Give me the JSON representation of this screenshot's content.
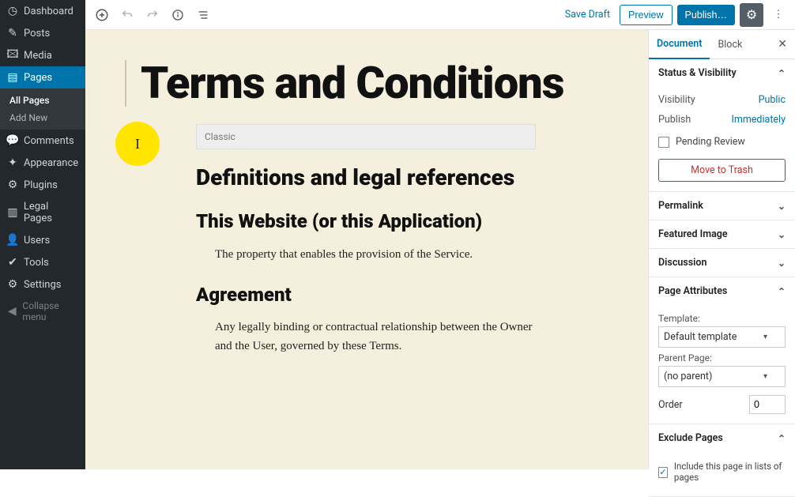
{
  "sidebar": {
    "items": [
      {
        "label": "Dashboard",
        "icon": "◷"
      },
      {
        "label": "Posts",
        "icon": "✎"
      },
      {
        "label": "Media",
        "icon": "🖾"
      },
      {
        "label": "Pages",
        "icon": "▤",
        "active": true
      },
      {
        "label": "Comments",
        "icon": "💬"
      },
      {
        "label": "Appearance",
        "icon": "✦"
      },
      {
        "label": "Plugins",
        "icon": "⚙"
      },
      {
        "label": "Legal Pages",
        "icon": "▥"
      },
      {
        "label": "Users",
        "icon": "👤"
      },
      {
        "label": "Tools",
        "icon": "✔"
      },
      {
        "label": "Settings",
        "icon": "⚙"
      }
    ],
    "subitems": [
      {
        "label": "All Pages",
        "current": true
      },
      {
        "label": "Add New"
      }
    ],
    "collapse": "Collapse menu"
  },
  "topbar": {
    "save_draft": "Save Draft",
    "preview": "Preview",
    "publish": "Publish…"
  },
  "editor": {
    "cursor_char": "I",
    "title": "Terms and Conditions",
    "classic_label": "Classic",
    "h2_1": "Definitions and legal references",
    "h3_1": "This Website (or this Application)",
    "p_1": "The property that enables the provision of the Service.",
    "h3_2": "Agreement",
    "p_2": "Any legally binding or contractual relationship between the Owner and the User, governed by these Terms."
  },
  "inspector": {
    "tabs": {
      "document": "Document",
      "block": "Block"
    },
    "status": {
      "title": "Status & Visibility",
      "visibility_label": "Visibility",
      "visibility_value": "Public",
      "publish_label": "Publish",
      "publish_value": "Immediately",
      "pending_label": "Pending Review",
      "trash": "Move to Trash"
    },
    "permalink_title": "Permalink",
    "featured_title": "Featured Image",
    "discussion_title": "Discussion",
    "pageattr": {
      "title": "Page Attributes",
      "template_label": "Template:",
      "template_value": "Default template",
      "parent_label": "Parent Page:",
      "parent_value": "(no parent)",
      "order_label": "Order",
      "order_value": "0"
    },
    "exclude": {
      "title": "Exclude Pages",
      "checkbox_label": "Include this page in lists of pages"
    }
  }
}
